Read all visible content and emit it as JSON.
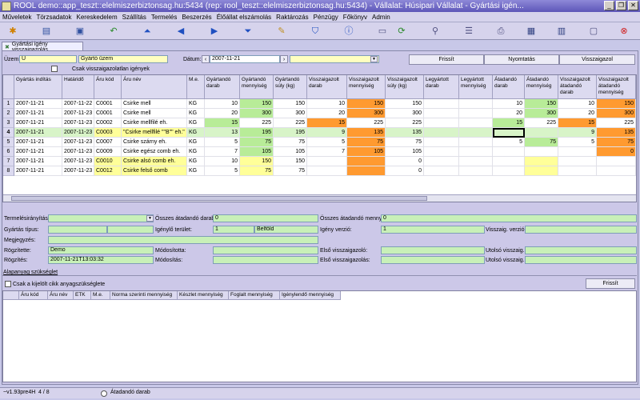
{
  "window": {
    "title": "ROOL demo::app_teszt::elelmiszerbiztonsag.hu:5434 (rep: rool_teszt::elelmiszerbiztonsag.hu:5434) - Vállalat: Húsipari Vállalat - Gyártási igén..."
  },
  "menu": [
    "Műveletek",
    "Törzsadatok",
    "Kereskedelem",
    "Szállítás",
    "Termelés",
    "Beszerzés",
    "Élőállat elszámolás",
    "Raktározás",
    "Pénzügy",
    "Főkönyv",
    "Admin"
  ],
  "tab": {
    "label": "Gyártási igény visszaigazolás"
  },
  "filters": {
    "uzem_label": "Üzem:",
    "uzem_code": "U",
    "uzem_name": "Gyártó üzem",
    "datum_label": "Dátum:",
    "datum_value": "2007-11-21",
    "unconfirmed_label": "Csak visszaigazolatlan igények",
    "btn_refresh": "Frissít",
    "btn_print": "Nyomtatás",
    "btn_confirm": "Visszaigazol"
  },
  "grid": {
    "headers": [
      "Gyártás indítás",
      "Határidő",
      "Áru kód",
      "Áru név",
      "M.e.",
      "Gyártandó darab",
      "Gyártandó mennyiség",
      "Gyártandó súly (kg)",
      "Visszaigazolt darab",
      "Visszaigazolt mennyiség",
      "Visszaigazolt súly (kg)",
      "Legyártott darab",
      "Legyártott mennyiség",
      "Átadandó darab",
      "Átadandó mennyiség",
      "Visszaigazolt átadandó darab",
      "Visszaigazolt átadandó mennyiség"
    ],
    "rows": [
      [
        "1",
        "2007-11-21",
        "2007-11-22",
        "C0001",
        "Csirke mell",
        "KG",
        "10",
        "150",
        "150",
        "10",
        "150",
        "150",
        "",
        "",
        "10",
        "150",
        "10",
        "150"
      ],
      [
        "2",
        "2007-11-21",
        "2007-11-23",
        "C0001",
        "Csirke mell",
        "KG",
        "20",
        "300",
        "300",
        "20",
        "300",
        "300",
        "",
        "",
        "20",
        "300",
        "20",
        "300"
      ],
      [
        "3",
        "2007-11-21",
        "2007-11-23",
        "C0002",
        "Csirke mellfilé eh.",
        "KG",
        "15",
        "225",
        "225",
        "15",
        "225",
        "225",
        "",
        "",
        "15",
        "225",
        "15",
        "225"
      ],
      [
        "4",
        "2007-11-21",
        "2007-11-23",
        "C0003",
        "\"Csirke mellfilé \"\"B\"\" eh.\"",
        "KG",
        "13",
        "195",
        "195",
        "9",
        "135",
        "135",
        "",
        "",
        "",
        "",
        "9",
        "135"
      ],
      [
        "5",
        "2007-11-21",
        "2007-11-23",
        "C0007",
        "Csirke szárny eh.",
        "KG",
        "5",
        "75",
        "75",
        "5",
        "75",
        "75",
        "",
        "",
        "5",
        "75",
        "5",
        "75"
      ],
      [
        "6",
        "2007-11-21",
        "2007-11-23",
        "C0009",
        "Csirke egész comb eh.",
        "KG",
        "7",
        "105",
        "105",
        "7",
        "105",
        "105",
        "",
        "",
        "",
        "",
        "",
        "0"
      ],
      [
        "7",
        "2007-11-21",
        "2007-11-23",
        "C0010",
        "Csirke alsó comb eh.",
        "KG",
        "10",
        "150",
        "150",
        "",
        "",
        "0",
        "",
        "",
        "",
        "",
        "",
        ""
      ],
      [
        "8",
        "2007-11-21",
        "2007-11-23",
        "C0012",
        "Csirke felső comb",
        "KG",
        "5",
        "75",
        "75",
        "",
        "",
        "0",
        "",
        "",
        "",
        "",
        "",
        ""
      ]
    ]
  },
  "details": {
    "termelesiranyitas_label": "Termelésirányítás:",
    "gyartas_tipus_label": "Gyártás típus:",
    "megjegyzes_label": "Megjegyzés:",
    "rogzitette_label": "Rögzítette:",
    "rogzitette_value": "Demo",
    "rogzites_label": "Rögzítés:",
    "rogzites_value": "2007-11-21T13:03:32",
    "osszes_darab_label": "Összes átadandó darab:",
    "osszes_darab_value": "0",
    "igenylo_terulet_label": "Igénylő terület:",
    "igenylo_terulet_code": "1",
    "igenylo_terulet_name": "Belföld",
    "modositotta_label": "Módosította:",
    "modositas_label": "Módosítás:",
    "osszes_menny_label": "Összes átadandó menny.:",
    "osszes_menny_value": "0",
    "igeny_verzio_label": "Igény verzió:",
    "igeny_verzio_value": "1",
    "elso_visszaigazolo_label": "Első visszaigazoló:",
    "elso_visszaigazolas_label": "Első visszaigazolás:",
    "visszaig_verzio_label": "Visszaig. verzió:",
    "utolso_visszaig_label": "Utolsó visszaig.:",
    "utolso_visszaigazolas_label": "Utolsó visszaig.:"
  },
  "materials": {
    "section_label": "Alapanyag szükséglet",
    "only_selected_label": "Csak a kijelölt cikk anyagszükséglete",
    "btn_refresh": "Frissít",
    "headers": [
      "Áru kód",
      "Áru név",
      "ETK",
      "M.e.",
      "Norma szerinti mennyiség",
      "Készlet mennyiség",
      "Foglalt mennyiség",
      "Igénylendő mennyiség"
    ]
  },
  "status": {
    "version": "~v1.93pre4H",
    "records": "4 / 8",
    "radio_label": "Átadandó darab"
  },
  "colors": {
    "green": "#b8ec98",
    "orange": "#ff9a30",
    "yellow": "#ffff99",
    "titlebar": "#5d56b8"
  }
}
